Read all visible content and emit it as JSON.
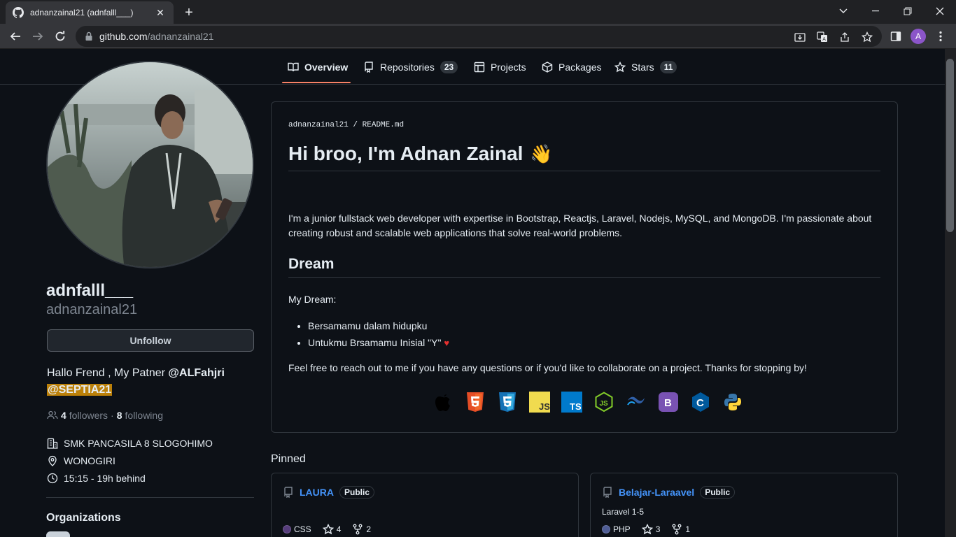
{
  "browser": {
    "tab_title": "adnanzainal21 (adnfalll___)",
    "new_tab": "+",
    "close": "✕",
    "url_host": "github.com",
    "url_path": "/adnanzainal21",
    "profile_initial": "A"
  },
  "nav": {
    "overview": "Overview",
    "repositories": "Repositories",
    "repositories_count": "23",
    "projects": "Projects",
    "packages": "Packages",
    "stars": "Stars",
    "stars_count": "11"
  },
  "profile": {
    "name": "adnfalll___",
    "login": "adnanzainal21",
    "unfollow": "Unfollow",
    "bio_prefix": "Hallo Frend , My Patner ",
    "bio_mention1": "@ALFahjri",
    "bio_mention2": "@SEPTIA21",
    "followers_count": "4",
    "followers_label": "followers",
    "dot": "·",
    "following_count": "8",
    "following_label": "following",
    "company": "SMK PANCASILA 8 SLOGOHIMO",
    "location": "WONOGIRI",
    "local_time": "15:15 - 19h behind",
    "organizations_heading": "Organizations"
  },
  "readme": {
    "path_user": "adnanzainal21",
    "path_sep": " / ",
    "path_file": "README.md",
    "heading": "Hi broo, I'm Adnan Zainal",
    "wave": "👋",
    "intro": "I'm a junior fullstack web developer with expertise in Bootstrap, Reactjs, Laravel, Nodejs, MySQL, and MongoDB. I'm passionate about creating robust and scalable web applications that solve real-world problems.",
    "dream_heading": "Dream",
    "dream_label": "My Dream:",
    "dream_item1": "Bersamamu dalam hidupku",
    "dream_item2": "Untukmu Brsamamu Inisial \"Y\"",
    "heart": "♥",
    "closing": "Feel free to reach out to me if you have any questions or if you'd like to collaborate on a project. Thanks for stopping by!",
    "tech_icons": [
      "apple-icon",
      "html5-icon",
      "css3-icon",
      "javascript-icon",
      "typescript-icon",
      "nodejs-icon",
      "tailwind-icon",
      "bootstrap-icon",
      "c-icon",
      "python-icon"
    ]
  },
  "pinned": {
    "label": "Pinned",
    "repos": [
      {
        "name": "LAURA",
        "visibility": "Public",
        "description": "",
        "language": "CSS",
        "language_color": "#563d7c",
        "stars": "4",
        "forks": "2"
      },
      {
        "name": "Belajar-Laraavel",
        "visibility": "Public",
        "description": "Laravel 1-5",
        "language": "PHP",
        "language_color": "#4F5D95",
        "stars": "3",
        "forks": "1"
      }
    ]
  },
  "colors": {
    "accent_link": "#4493f8",
    "nav_underline": "#f78166",
    "mention_highlight": "#bb8009"
  }
}
